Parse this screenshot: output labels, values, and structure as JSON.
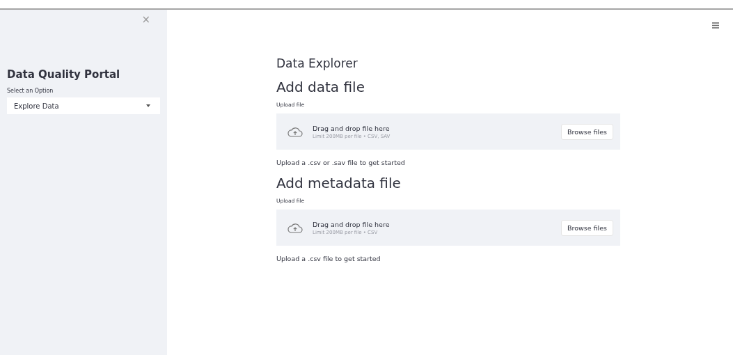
{
  "sidebar": {
    "close_icon": "×",
    "title": "Data Quality Portal",
    "select": {
      "label": "Select an Option",
      "value": "Explore Data"
    }
  },
  "main": {
    "title": "Data Explorer",
    "sections": [
      {
        "heading": "Add data file",
        "uploader": {
          "label": "Upload file",
          "prompt": "Drag and drop file here",
          "limit": "Limit 200MB per file • CSV, SAV",
          "button": "Browse files"
        },
        "message": "Upload a .csv or .sav file to get started"
      },
      {
        "heading": "Add metadata file",
        "uploader": {
          "label": "Upload file",
          "prompt": "Drag and drop file here",
          "limit": "Limit 200MB per file • CSV",
          "button": "Browse files"
        },
        "message": "Upload a .csv file to get started"
      }
    ]
  }
}
